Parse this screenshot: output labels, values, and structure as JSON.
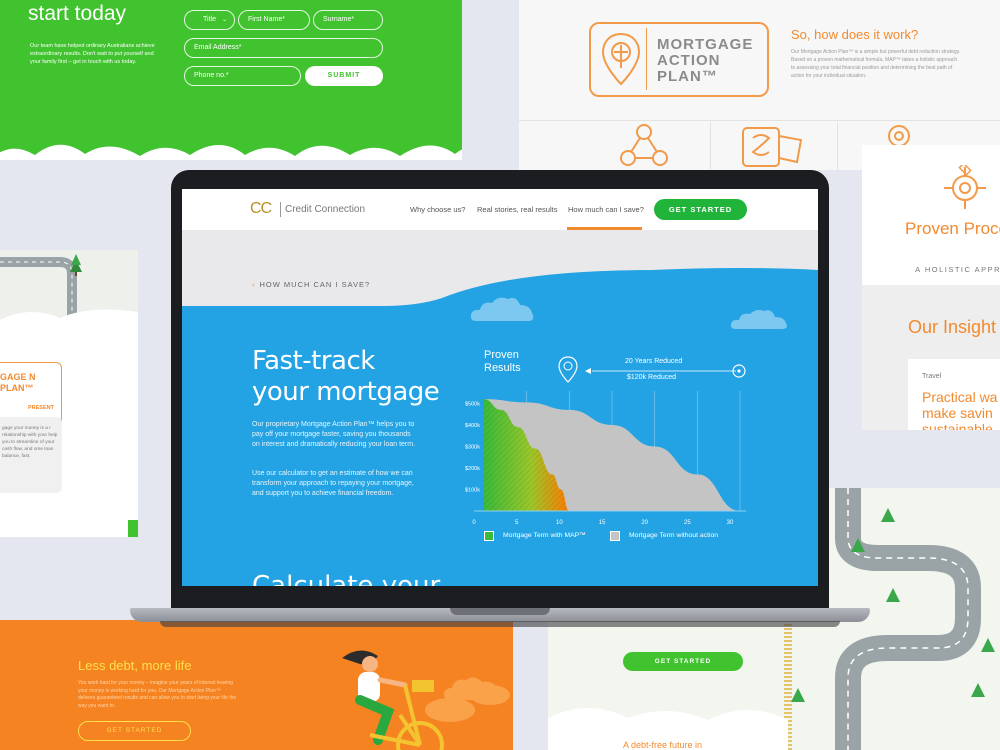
{
  "colors": {
    "brand_green": "#20b43b",
    "panel_green": "#41c22f",
    "sky_blue": "#23a3e3",
    "accent_orange": "#f28a2e",
    "logo_gold": "#b8912a"
  },
  "bg_form": {
    "title": "start today",
    "description": "Our team have helped ordinary Australians achieve extraordinary results. Don't wait to put yourself and your family first – get in touch with us today.",
    "title_select": "Title",
    "first_name_placeholder": "First Name*",
    "surname_placeholder": "Surname*",
    "email_placeholder": "Email Address*",
    "phone_placeholder": "Phone no.*",
    "submit_label": "SUBMIT"
  },
  "bg_map": {
    "logo_text": "MORTGAGE ACTION PLAN™",
    "question": "So, how does it work?",
    "description": "Our Mortgage Action Plan™ is a simple but powerful debt reduction strategy. Based on a proven mathematical formula, MAP™ takes a holistic approach to assessing your total financial position and determining the best path of action for your individual situation."
  },
  "bg_proven": {
    "title": "Proven Process",
    "subtitle": "A HOLISTIC APPROA",
    "insights": "Our Insight",
    "card_tag": "Travel",
    "card_title": "Practical wa make savin sustainable"
  },
  "bg_left": {
    "card_title": "GAGE N PLAN™",
    "present": "PRESENT",
    "text": "gage your money is a r relationship with your help you to streamline of your cash flow, and ome loan balance, fast."
  },
  "bg_orange": {
    "title": "Less debt, more life",
    "description": "You work hard for your money – imagine your years of interest leaving your money is working hard for you. Our Mortgage Action Plan™ delivers guaranteed results and can allow you to start living your life the way you want to.",
    "button": "GET STARTED"
  },
  "bg_road": {
    "button": "GET STARTED",
    "bottom_text": "A debt-free future in"
  },
  "site": {
    "logo_mark": "CC",
    "logo_name": "Credit Connection",
    "nav": [
      "Why choose us?",
      "Real stories, real results",
      "How much can I save?"
    ],
    "cta": "GET STARTED",
    "breadcrumb": "HOW MUCH CAN I SAVE?",
    "hero_line1": "Fast-track",
    "hero_line2": "your mortgage",
    "hero_p1": "Our proprietary Mortgage Action Plan™ helps you to pay off your mortgage faster, saving you thousands on interest and dramatically reducing your loan term.",
    "hero_p2": "Use our calculator to get an estimate of how we can transform your approach to repaying your mortgage, and support you to achieve financial freedom.",
    "calc_title": "Calculate your"
  },
  "chart_data": {
    "type": "area",
    "title": "Proven Results",
    "annotations": [
      "20 Years Reduced",
      "$120k Reduced"
    ],
    "x_ticks": [
      "0",
      "5",
      "10",
      "15",
      "20",
      "25",
      "30"
    ],
    "y_ticks": [
      "$100k",
      "$200k",
      "$300k",
      "$400k",
      "$500k"
    ],
    "xlim": [
      0,
      30
    ],
    "ylim": [
      0,
      530
    ],
    "series": [
      {
        "name": "Mortgage Term with MAP™",
        "color": "gradient green-orange",
        "x": [
          0,
          2,
          4,
          6,
          8,
          9,
          10
        ],
        "y": [
          520,
          470,
          390,
          290,
          170,
          100,
          0
        ]
      },
      {
        "name": "Mortgage Term without action",
        "color": "#c4c4c4",
        "x": [
          0,
          5,
          10,
          15,
          20,
          25,
          30
        ],
        "y": [
          520,
          505,
          470,
          400,
          300,
          170,
          0
        ]
      }
    ],
    "grid": true
  }
}
